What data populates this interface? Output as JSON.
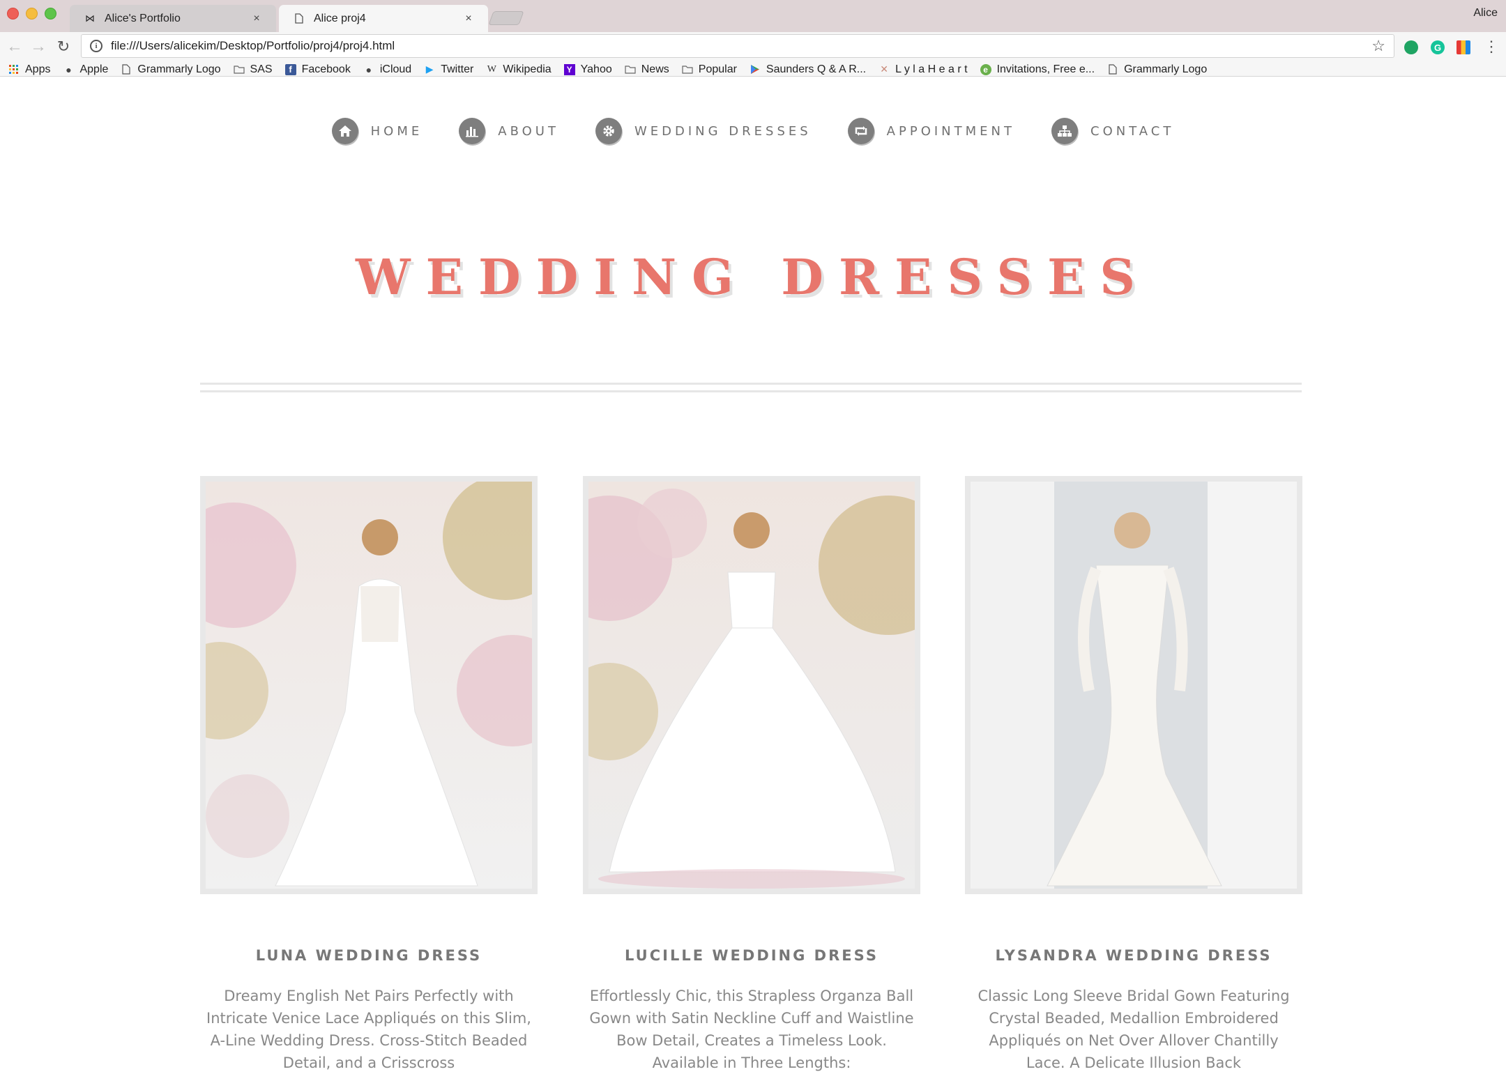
{
  "browser": {
    "tabs": [
      {
        "title": "Alice's Portfolio",
        "icon": "bowtie-icon"
      },
      {
        "title": "Alice proj4",
        "icon": "document-icon"
      }
    ],
    "profile_name": "Alice",
    "url": "file:///Users/alicekim/Desktop/Portfolio/proj4/proj4.html",
    "bookmarks": [
      {
        "label": "Apps",
        "icon": "apps-grid-icon"
      },
      {
        "label": "Apple",
        "icon": "apple-icon"
      },
      {
        "label": "Grammarly Logo",
        "icon": "document-icon"
      },
      {
        "label": "SAS",
        "icon": "folder-icon"
      },
      {
        "label": "Facebook",
        "icon": "facebook-icon"
      },
      {
        "label": "iCloud",
        "icon": "apple-icon"
      },
      {
        "label": "Twitter",
        "icon": "twitter-icon"
      },
      {
        "label": "Wikipedia",
        "icon": "wikipedia-icon"
      },
      {
        "label": "Yahoo",
        "icon": "yahoo-icon"
      },
      {
        "label": "News",
        "icon": "folder-icon"
      },
      {
        "label": "Popular",
        "icon": "folder-icon"
      },
      {
        "label": "Saunders Q & A R...",
        "icon": "play-store-icon"
      },
      {
        "label": "L y l a H e a r t",
        "icon": "lylaheart-icon"
      },
      {
        "label": "Invitations, Free e...",
        "icon": "evite-icon"
      },
      {
        "label": "Grammarly Logo",
        "icon": "document-icon"
      }
    ]
  },
  "nav": [
    {
      "label": "HOME",
      "icon": "home-icon"
    },
    {
      "label": "ABOUT",
      "icon": "bar-chart-icon"
    },
    {
      "label": "WEDDING DRESSES",
      "icon": "gear-icon"
    },
    {
      "label": "APPOINTMENT",
      "icon": "retweet-icon"
    },
    {
      "label": "CONTACT",
      "icon": "sitemap-icon"
    }
  ],
  "page": {
    "title": "WEDDING DRESSES"
  },
  "cards": [
    {
      "title": "LUNA WEDDING DRESS",
      "description": "Dreamy English Net Pairs Perfectly with Intricate Venice Lace Appliqués on this Slim, A-Line Wedding Dress. Cross-Stitch Beaded Detail, and a Crisscross"
    },
    {
      "title": "LUCILLE WEDDING DRESS",
      "description": "Effortlessly Chic, this Strapless Organza Ball Gown with Satin Neckline Cuff and Waistline Bow Detail, Creates a Timeless Look. Available in Three Lengths:"
    },
    {
      "title": "LYSANDRA WEDDING DRESS",
      "description": "Classic Long Sleeve Bridal Gown Featuring Crystal Beaded, Medallion Embroidered Appliqués on Net Over Allover Chantilly Lace. A Delicate Illusion Back"
    }
  ],
  "colors": {
    "title": "#e8766c",
    "nav_icon": "#7e7e7e",
    "nav_text": "#707070",
    "card_text": "#888888"
  }
}
